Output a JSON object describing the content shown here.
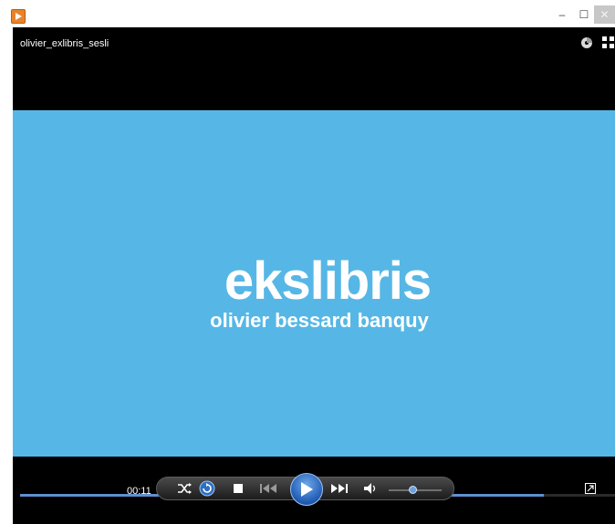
{
  "window": {
    "minimize_glyph": "–",
    "maximize_glyph": "☐",
    "close_glyph": "✕"
  },
  "player": {
    "media_title": "olivier_exlibris_sesli",
    "video": {
      "title": "ekslibris",
      "subtitle": "olivier bessard banquy",
      "background_color": "#56b7e6"
    },
    "seek_progress": 0.88,
    "elapsed_time": "00:11",
    "volume_level": 0.45,
    "icons": [
      "media-player-app-icon",
      "rip-cd-icon",
      "switch-to-library-icon",
      "shuffle-icon",
      "repeat-icon",
      "stop-icon",
      "previous-icon",
      "play-icon",
      "next-icon",
      "volume-icon",
      "fullscreen-icon"
    ],
    "accent_color": "#5e8fd0"
  }
}
